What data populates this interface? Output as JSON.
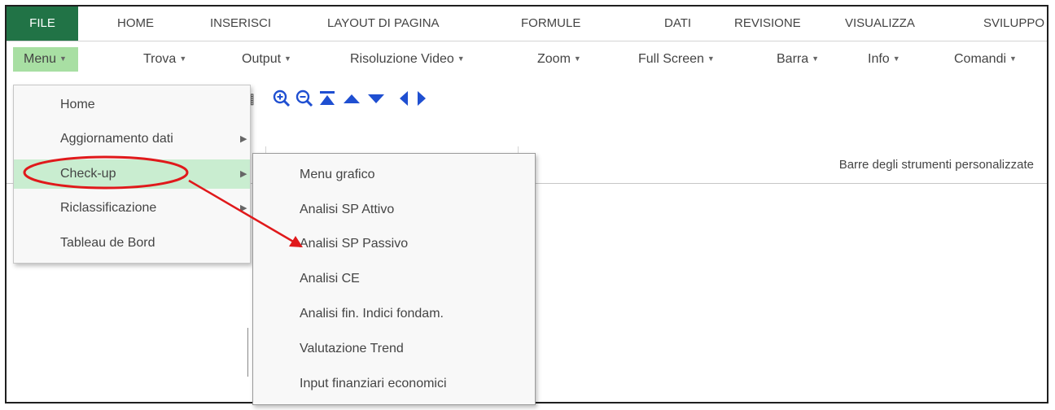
{
  "ribbon_tabs": [
    "FILE",
    "HOME",
    "INSERISCI",
    "LAYOUT DI PAGINA",
    "FORMULE",
    "DATI",
    "REVISIONE",
    "VISUALIZZA",
    "SVILUPPO"
  ],
  "toolbar": [
    "Menu",
    "Trova",
    "Output",
    "Risoluzione Video",
    "Zoom",
    "Full Screen",
    "Barra",
    "Info",
    "Comandi"
  ],
  "group_label": "Barre degli strumenti personalizzate",
  "menu_items": [
    {
      "label": "Home",
      "submenu": false
    },
    {
      "label": "Aggiornamento dati",
      "submenu": true
    },
    {
      "label": "Check-up",
      "submenu": true
    },
    {
      "label": "Riclassificazione",
      "submenu": true
    },
    {
      "label": "Tableau de Bord",
      "submenu": false
    }
  ],
  "submenu_items": [
    "Menu grafico",
    "Analisi SP Attivo",
    "Analisi SP Passivo",
    "Analisi CE",
    "Analisi fin. Indici fondam.",
    "Valutazione Trend",
    "Input finanziari economici"
  ],
  "icons": [
    "grid-icon",
    "zoom-in-icon",
    "zoom-out-icon",
    "first-page-icon",
    "arrow-up-icon",
    "arrow-down-icon",
    "arrow-left-icon",
    "arrow-right-icon"
  ],
  "colors": {
    "file_tab": "#217346",
    "menu_button": "#a8dfa3",
    "menu_highlight": "#c9edd0",
    "annotation": "#e0191b",
    "nav_icons": "#1f4fd1"
  }
}
